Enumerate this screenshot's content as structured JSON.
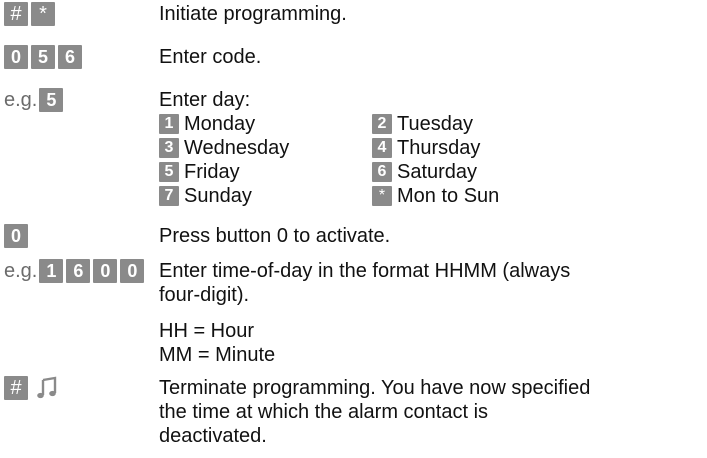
{
  "rows": [
    {
      "keys": [
        "#",
        "*"
      ],
      "desc": "Initiate programming."
    },
    {
      "keys": [
        "0",
        "5",
        "6"
      ],
      "desc": "Enter code."
    },
    {
      "prefix": "e.g.",
      "keys": [
        "5"
      ],
      "desc": "Enter day:"
    },
    {
      "keys": [
        "0"
      ],
      "desc": "Press button 0 to activate."
    },
    {
      "prefix": "e.g.",
      "keys": [
        "1",
        "6",
        "0",
        "0"
      ],
      "desc_lines": [
        "Enter time-of-day in the format HHMM (always",
        "four-digit)."
      ],
      "extra_lines": [
        "HH = Hour",
        "MM = Minute"
      ]
    },
    {
      "keys": [
        "#"
      ],
      "icon": "music-note-icon",
      "desc_lines": [
        "Terminate programming. You have now specified",
        "the time at which the alarm contact is",
        "deactivated."
      ]
    }
  ],
  "days": [
    {
      "key": "1",
      "label": "Monday"
    },
    {
      "key": "2",
      "label": "Tuesday"
    },
    {
      "key": "3",
      "label": "Wednesday"
    },
    {
      "key": "4",
      "label": "Thursday"
    },
    {
      "key": "5",
      "label": "Friday"
    },
    {
      "key": "6",
      "label": "Saturday"
    },
    {
      "key": "7",
      "label": "Sunday"
    },
    {
      "key": "*",
      "label": "Mon to Sun"
    }
  ],
  "colors": {
    "key_bg": "#8a8a8a",
    "key_text": "#ffffff",
    "prefix": "#6b6b6b"
  }
}
